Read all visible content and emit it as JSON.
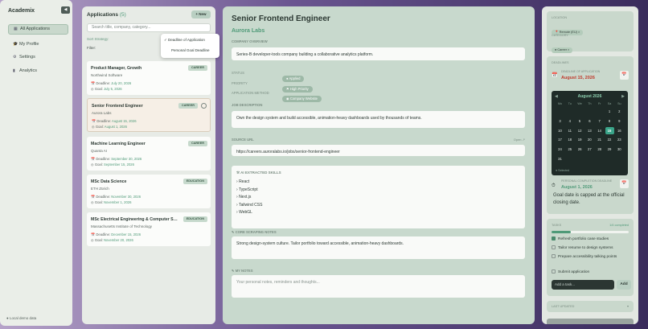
{
  "sidebar": {
    "brand": "Academix",
    "nav": [
      "All Applications",
      "My Profile",
      "Settings",
      "Analytics"
    ],
    "footer": "Local demo data"
  },
  "list": {
    "title": "Applications",
    "count": "(5)",
    "new_btn": "+ New",
    "search_placeholder": "Search title, company, category...",
    "sort_label": "Sort Strategy:",
    "filter_label": "Filter:",
    "sort_options": [
      "Deadline of Application",
      "Personal Goal Deadline"
    ],
    "cards": [
      {
        "title": "Product Manager, Growth",
        "company": "Northwind Software",
        "badge": "CAREER",
        "deadline": "July 20, 2026",
        "goal": "July 5, 2026"
      },
      {
        "title": "Senior Frontend Engineer",
        "company": "Aurora Labs",
        "badge": "CAREER",
        "deadline": "August 15, 2026",
        "goal": "August 1, 2026"
      },
      {
        "title": "Machine Learning Engineer",
        "company": "Quanta AI",
        "badge": "CAREER",
        "deadline": "September 30, 2026",
        "goal": "September 15, 2026"
      },
      {
        "title": "MSc Data Science",
        "company": "ETH Zürich",
        "badge": "EDUCATION",
        "deadline": "November 30, 2026",
        "goal": "November 1, 2026"
      },
      {
        "title": "MSc Electrical Engineering & Computer Science",
        "company": "Massachusetts Institute of Technology",
        "badge": "EDUCATION",
        "deadline": "December 15, 2026",
        "goal": "November 20, 2026"
      }
    ],
    "deadline_prefix": "Deadline:",
    "goal_prefix": "Goal:"
  },
  "detail": {
    "title": "Senior Frontend Engineer",
    "company": "Aurora Labs",
    "overview_label": "COMPANY OVERVIEW",
    "overview": "Series-B developer-tools company building a collaborative analytics platform.",
    "status_label": "STATUS",
    "status": "Applied",
    "priority_label": "PRIORITY",
    "priority": "High Priority",
    "method_label": "APPLICATION METHOD",
    "method": "Company Website",
    "job_label": "JOB DESCRIPTION",
    "job": "Own the design system and build accessible, animation-heavy dashboards used by thousands of teams.",
    "url_label": "SOURCE URL",
    "url_open": "Open ↗",
    "url": "https://careers.auroralabs.io/jobs/senior-frontend-engineer",
    "skills_label": "AI EXTRACTED SKILLS",
    "skills": [
      "React",
      "TypeScript",
      "Next.js",
      "Tailwind CSS",
      "WebGL"
    ],
    "notes_label": "CORE SCRAPING NOTES",
    "notes": "Strong design-system culture. Tailor portfolio toward accessible, animation-heavy dashboards.",
    "mynotes_label": "MY NOTES",
    "mynotes_placeholder": "Your personal notes, reminders and thoughts..."
  },
  "right": {
    "location_label": "LOCATION",
    "location": "Remote (EU)",
    "category_label": "CATEGORY",
    "category": "Career",
    "deadlines_label": "DEADLINES",
    "deadline_label": "DEADLINE OF APPLICATION",
    "deadline": "August 15, 2026",
    "cal_month": "August 2026",
    "weekdays": [
      "Mo",
      "Tu",
      "We",
      "Th",
      "Fr",
      "Sa",
      "Su"
    ],
    "selected_day": "15",
    "cal_legend": "Selected",
    "goal_label": "PERSONAL COMPLETION DEADLINE",
    "goal": "August 1, 2026",
    "goal_note": "Goal date is capped at the official closing date.",
    "tasks_label": "TASKS",
    "tasks_progress": "1/4 completed",
    "progress": 0.25,
    "tasks": [
      {
        "text": "Refresh portfolio case studies",
        "done": true
      },
      {
        "text": "Tailor resume to design systems",
        "done": false
      },
      {
        "text": "Prepare accessibility talking points",
        "done": false
      },
      {
        "text": "Submit application",
        "done": false
      }
    ],
    "task_placeholder": "Add a task...",
    "add_btn": "Add",
    "updated_label": "LAST UPDATED"
  },
  "colors": {
    "accent": "#4f9a78",
    "deadline_red": "#c0392b",
    "calendar_bg": "#1f2b28"
  }
}
